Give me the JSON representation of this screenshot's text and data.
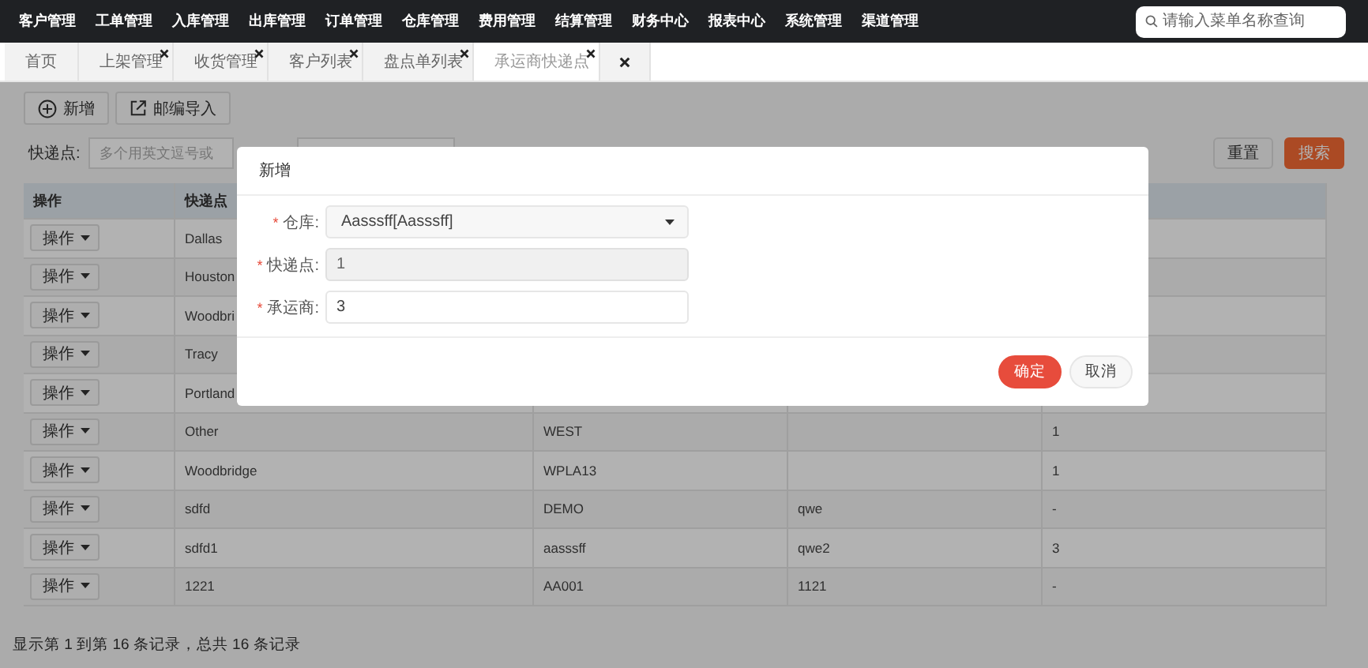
{
  "nav": {
    "menu": [
      "客户管理",
      "工单管理",
      "入库管理",
      "出库管理",
      "订单管理",
      "仓库管理",
      "费用管理",
      "结算管理",
      "财务中心",
      "报表中心",
      "系统管理",
      "渠道管理"
    ],
    "search": {
      "placeholder": "请输入菜单名称查询"
    }
  },
  "tabs": [
    {
      "kind": "tab",
      "label": "首页",
      "closable": false,
      "selected": false
    },
    {
      "kind": "tab",
      "label": "上架管理",
      "closable": true,
      "selected": false
    },
    {
      "kind": "tab",
      "label": "收货管理",
      "closable": true,
      "selected": false
    },
    {
      "kind": "tab",
      "label": "客户列表",
      "closable": true,
      "selected": false
    },
    {
      "kind": "tab",
      "label": "盘点单列表",
      "closable": true,
      "selected": false
    },
    {
      "kind": "tab",
      "label": "承运商快递点",
      "closable": true,
      "selected": true
    },
    {
      "kind": "close_all",
      "selected": false
    }
  ],
  "toolbar": [
    {
      "kind": "add",
      "label": "新增"
    },
    {
      "kind": "import",
      "label": "邮编导入"
    }
  ],
  "filter": {
    "label": "快递点:",
    "placeholder": "多个用英文逗号或"
  },
  "filter_buttons": [
    {
      "kind": "default",
      "label": "重置"
    },
    {
      "kind": "primary",
      "label": "搜索"
    }
  ],
  "table": {
    "columns": [
      "操作",
      "快递点"
    ],
    "rows": [
      {
        "cells": [
          "操作",
          "Dallas"
        ]
      },
      {
        "cells": [
          "操作",
          "Houston"
        ]
      },
      {
        "cells": [
          "操作",
          "Woodbri"
        ]
      },
      {
        "cells": [
          "操作",
          "Tracy"
        ]
      },
      {
        "cells": [
          "操作",
          "Portland"
        ]
      },
      {
        "cells": [
          "操作",
          "Other",
          "WEST",
          "",
          "1"
        ]
      },
      {
        "cells": [
          "操作",
          "Woodbridge",
          "WPLA13",
          "",
          "1"
        ]
      },
      {
        "cells": [
          "操作",
          "sdfd",
          "DEMO",
          "qwe",
          "-"
        ]
      },
      {
        "cells": [
          "操作",
          "sdfd1",
          "aasssff",
          "qwe2",
          "3"
        ]
      },
      {
        "cells": [
          "操作",
          "1221",
          "AA001",
          "1121",
          "-"
        ]
      }
    ]
  },
  "status_bar": "显示第 1 到第 16 条记录，总共 16 条记录",
  "modal": {
    "title": "新增",
    "fields": [
      {
        "kind": "select",
        "required_mark": "*",
        "label": "仓库:",
        "value": "Aasssff[Aasssff]"
      },
      {
        "kind": "input",
        "required_mark": "*",
        "label": "快递点:",
        "value": "1",
        "disabled": true
      },
      {
        "kind": "input",
        "required_mark": "*",
        "label": "承运商:",
        "value": "3",
        "disabled": false
      }
    ],
    "buttons": [
      {
        "kind": "primary",
        "label": "确定"
      },
      {
        "kind": "default",
        "label": "取消"
      }
    ]
  }
}
